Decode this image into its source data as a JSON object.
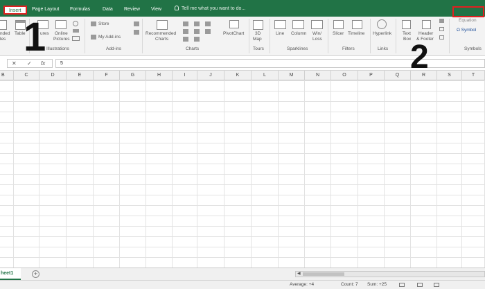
{
  "tabs": {
    "insert": "Insert",
    "page_layout": "Page Layout",
    "formulas": "Formulas",
    "data": "Data",
    "review": "Review",
    "view": "View",
    "tell_me": "Tell me what you want to do..."
  },
  "ribbon": {
    "tables": {
      "recommended": "nded",
      "recommended2": "les",
      "table": "Table"
    },
    "illustrations": {
      "pictures": "ures",
      "online_pictures_1": "Online",
      "online_pictures_2": "Pictures",
      "group": "Illustrations"
    },
    "addins": {
      "store": "Store",
      "my_addins": "My Add-ins",
      "group": "Add-ins"
    },
    "charts": {
      "recommended_1": "Recommended",
      "recommended_2": "Charts",
      "pivotchart": "PivotChart",
      "group": "Charts"
    },
    "tours": {
      "map_1": "3D",
      "map_2": "Map",
      "group": "Tours"
    },
    "sparklines": {
      "line": "Line",
      "column": "Column",
      "winloss_1": "Win/",
      "winloss_2": "Loss",
      "group": "Sparklines"
    },
    "filters": {
      "slicer": "Slicer",
      "timeline": "Timeline",
      "group": "Filters"
    },
    "links": {
      "hyperlink": "Hyperlink",
      "group": "Links"
    },
    "text": {
      "textbox_1": "Text",
      "textbox_2": "Box",
      "header_1": "Header",
      "header_2": "& Footer"
    },
    "symbols": {
      "equation": "Equation",
      "symbol": "Symbol",
      "group": "Symbols"
    }
  },
  "annotations": {
    "step1": "1",
    "step2": "2"
  },
  "formula_bar": {
    "cancel": "✕",
    "enter": "✓",
    "fx": "fx",
    "value": "5"
  },
  "columns": [
    "B",
    "C",
    "D",
    "E",
    "F",
    "G",
    "H",
    "I",
    "J",
    "K",
    "L",
    "M",
    "N",
    "O",
    "P",
    "Q",
    "R",
    "S",
    "T"
  ],
  "sheet": {
    "name": "heet1",
    "add": "+"
  },
  "status": {
    "average": "Average: +4",
    "count": "Count: 7",
    "sum": "Sum: +25"
  },
  "colors": {
    "ribbon_green": "#217346",
    "highlight_red": "#e02020"
  }
}
